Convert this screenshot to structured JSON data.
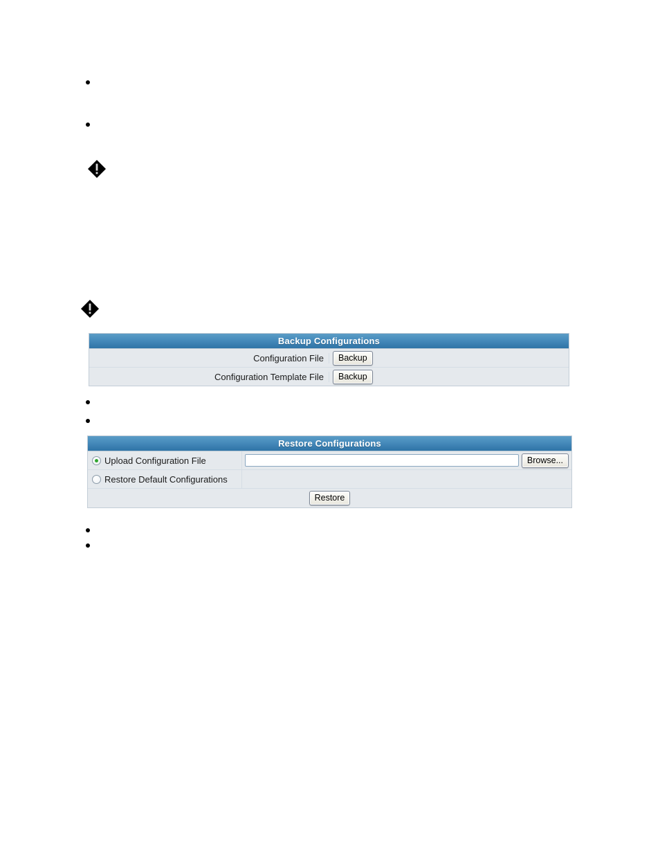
{
  "document": {
    "bullets_top": [
      {
        "name": "bullet-item-1"
      },
      {
        "name": "bullet-item-2"
      }
    ],
    "warning_icons": [
      {
        "name": "warning-diamond-icon-1",
        "glyph": "!"
      },
      {
        "name": "warning-diamond-icon-2",
        "glyph": "!"
      }
    ],
    "bullets_middle": [
      {
        "name": "bullet-item-3"
      },
      {
        "name": "bullet-item-4"
      }
    ],
    "bullets_bottom": [
      {
        "name": "bullet-item-5"
      },
      {
        "name": "bullet-item-6"
      }
    ]
  },
  "colors": {
    "header_gradient_top": "#5b9cc6",
    "header_gradient_bottom": "#2f74a6",
    "panel_row_bg": "#e5e9ed",
    "panel_border": "#c3cdd7",
    "row_divider": "#d5dde5",
    "radio_dot_green": "#2fa52f",
    "header_text": "#ffffff"
  },
  "backup_panel": {
    "title": "Backup Configurations",
    "rows": [
      {
        "label": "Configuration File",
        "button_label": "Backup"
      },
      {
        "label": "Configuration Template File",
        "button_label": "Backup"
      }
    ]
  },
  "restore_panel": {
    "title": "Restore Configurations",
    "options": [
      {
        "label": "Upload Configuration File",
        "selected": true
      },
      {
        "label": "Restore Default Configurations",
        "selected": false
      }
    ],
    "upload_field": {
      "value": "",
      "placeholder": ""
    },
    "browse_label": "Browse...",
    "restore_label": "Restore"
  }
}
